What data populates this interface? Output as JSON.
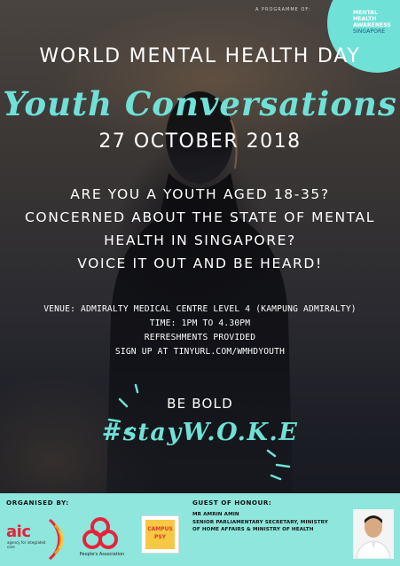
{
  "programme_label": "A PROGRAMME OF:",
  "mha_badge": {
    "lines": [
      "MENTAL",
      "HEALTH",
      "AWARENESS"
    ],
    "country": "SINGAPORE",
    "color": "#6fe1d7"
  },
  "title": {
    "main": "WORLD MENTAL HEALTH DAY",
    "script": "Youth Conversations",
    "date": "27 OCTOBER 2018"
  },
  "questions": [
    "ARE YOU A YOUTH AGED 18-35?",
    "CONCERNED ABOUT THE STATE OF MENTAL",
    "HEALTH IN SINGAPORE?",
    "VOICE IT OUT AND BE HEARD!"
  ],
  "details": {
    "venue": "VENUE: ADMIRALTY MEDICAL CENTRE LEVEL 4 (KAMPUNG ADMIRALTY)",
    "time": "TIME: 1PM TO 4.30PM",
    "refreshments": "REFRESHMENTS PROVIDED",
    "signup": "SIGN UP AT TINYURL.COM/WMHDYOUTH"
  },
  "be_bold": "BE BOLD",
  "hashtag": "#stayW.O.K.E",
  "accent_color": "#6fe1d7",
  "footer": {
    "organised_by": "ORGANISED BY:",
    "aic": {
      "name": "aic",
      "tagline": "agency for integrated care"
    },
    "pa": {
      "label": "People's Association"
    },
    "campus_psy": {
      "line1": "CAMPUS",
      "line2": "PSY"
    },
    "guest_of_honour": {
      "label": "GUEST OF HONOUR:",
      "name": "MR AMRIN AMIN",
      "title_line1": "SENIOR PARLIAMENTARY SECRETARY, MINISTRY",
      "title_line2": "OF HOME AFFAIRS & MINISTRY OF HEALTH"
    }
  }
}
